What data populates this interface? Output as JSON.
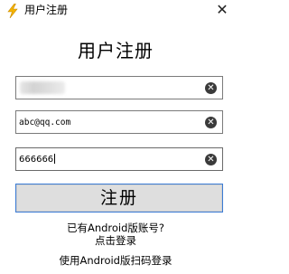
{
  "window": {
    "title": "用户注册",
    "app_icon": "lightning-bolt-icon",
    "close_icon": "close-icon",
    "close_glyph": "✕"
  },
  "form": {
    "heading": "用户注册",
    "fields": [
      {
        "name": "phone",
        "value": "",
        "redacted": true
      },
      {
        "name": "email",
        "value": "abc@qq.com"
      },
      {
        "name": "password",
        "value": "666666"
      }
    ],
    "clear_glyph": "✕",
    "submit_label": "注册"
  },
  "footer": {
    "have_account": "已有Android版账号?",
    "login_link": "点击登录",
    "qr_login": "使用Android版扫码登录"
  },
  "colors": {
    "button_border": "#3a7bd5",
    "button_bg": "#dedede",
    "icon_yellow": "#f5b400"
  }
}
